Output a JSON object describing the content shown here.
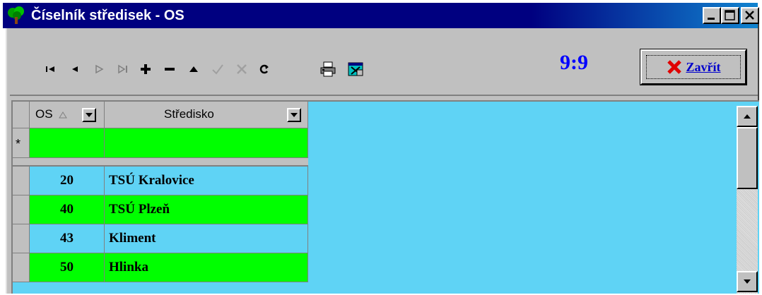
{
  "window": {
    "title": "Číselník středisek - OS",
    "controls": [
      "minimize-icon",
      "maximize-icon",
      "close-icon"
    ]
  },
  "toolbar": {
    "nav_icons": [
      "first-record-icon",
      "previous-record-icon",
      "next-record-icon",
      "last-record-icon",
      "add-record-icon",
      "delete-record-icon",
      "edit-record-icon",
      "confirm-icon",
      "cancel-icon",
      "refresh-icon",
      "print-icon",
      "export-icon"
    ],
    "counter": "9:9",
    "close_label": "Zavřít"
  },
  "grid": {
    "columns": [
      {
        "label": "OS",
        "sort": "ascending"
      },
      {
        "label": "Středisko"
      }
    ],
    "new_row_marker": "*",
    "rows": [
      {
        "os": "20",
        "stredisko": "TSÚ Kralovice",
        "color": "#ffffff"
      },
      {
        "os": "40",
        "stredisko": "TSÚ Plzeň",
        "color": "#00ff00"
      },
      {
        "os": "43",
        "stredisko": "Kliment",
        "color": "#ffffff"
      },
      {
        "os": "50",
        "stredisko": "Hlinka",
        "color": "#00ff00"
      }
    ]
  },
  "colors": {
    "title_bar": "#000080",
    "grid_background": "#5fd3f5",
    "highlight_row": "#00ff00",
    "counter": "#0000ff"
  }
}
